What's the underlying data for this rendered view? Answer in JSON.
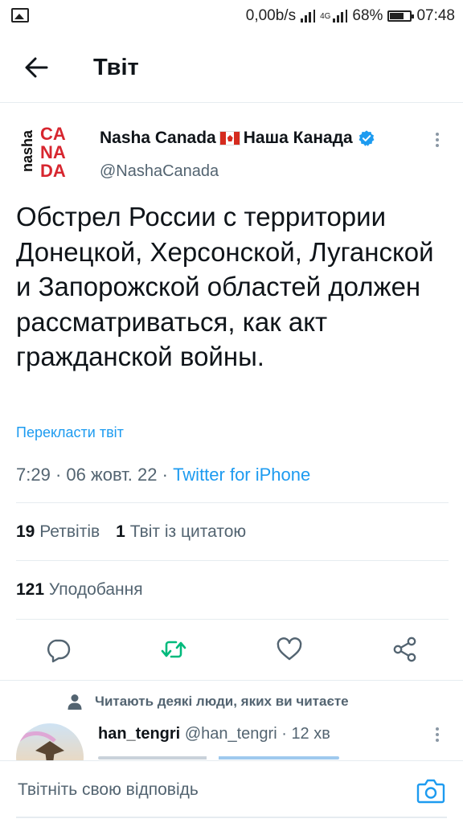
{
  "status_bar": {
    "network_speed": "0,00b/s",
    "network_type": "4G",
    "battery": "68%",
    "time": "07:48"
  },
  "header": {
    "title": "Твіт",
    "back_icon": "arrow-left-icon"
  },
  "tweet": {
    "author_name": "Nasha Canada",
    "author_name_cyrillic": "Наша Канада",
    "flag": "canada-flag",
    "verified": true,
    "handle": "@NashaCanada",
    "avatar_logo": {
      "line1": "nasha",
      "line2": "CA",
      "line3": "NA",
      "line4": "DA",
      "accent": "#d7262f"
    },
    "text": "Обстрел России с территории Донецкой, Херсонской, Луганской и Запорожской областей должен рассматриваться, как акт гражданской войны.",
    "translate_label": "Перекласти твіт",
    "time": "7:29",
    "date": "06 жовт. 22",
    "separator": "·",
    "source": "Twitter for iPhone",
    "retweets_count": "19",
    "retweets_label": "Ретвітів",
    "quotes_count": "1",
    "quotes_label": "Твіт із цитатою",
    "likes_count": "121",
    "likes_label": "Уподобання"
  },
  "actions": [
    {
      "name": "reply",
      "icon": "comment-icon",
      "color": "#536471"
    },
    {
      "name": "retweet",
      "icon": "retweet-icon",
      "color": "#00ba7c"
    },
    {
      "name": "like",
      "icon": "heart-icon",
      "color": "#536471"
    },
    {
      "name": "share",
      "icon": "share-icon",
      "color": "#536471"
    }
  ],
  "reply_section": {
    "social_context": "Читають деякі люди, яких ви читаєте",
    "reply": {
      "name": "han_tengri",
      "handle": "@han_tengri",
      "age": "12 хв"
    }
  },
  "composer": {
    "placeholder": "Твітніть свою відповідь",
    "camera_icon": "camera-icon"
  },
  "colors": {
    "accent": "#1d9bf0",
    "retweet_green": "#00ba7c",
    "text_primary": "#0f1419",
    "text_secondary": "#536471"
  }
}
